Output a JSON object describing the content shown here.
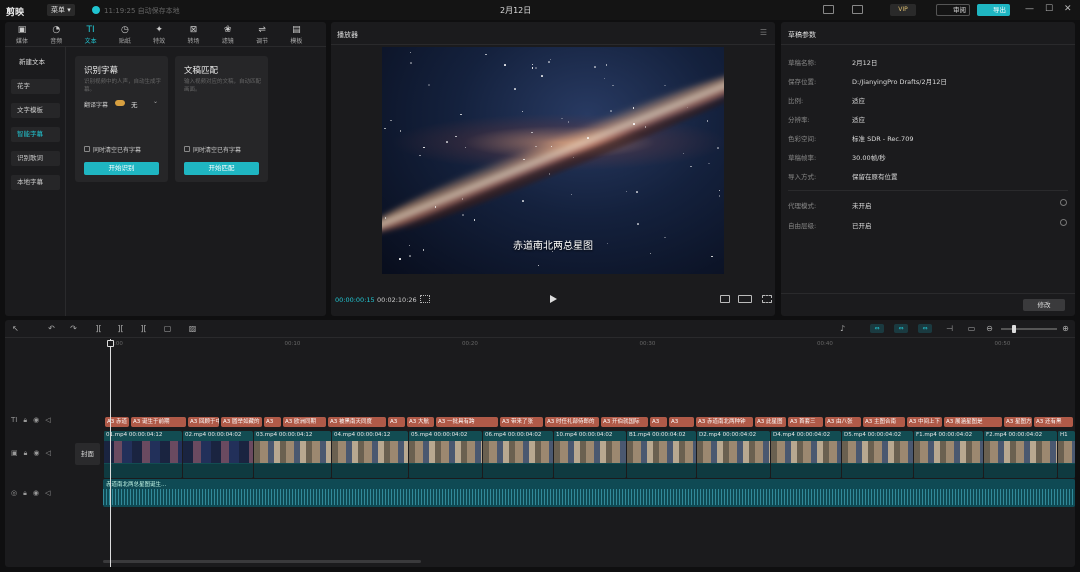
{
  "titlebar": {
    "app_name": "剪映",
    "menu": "菜单 ▾",
    "autosave": "11:19:25 自动保存本地",
    "title": "2月12日",
    "vip": "VIP",
    "review": "审阅",
    "export": "导出",
    "minimize": "—",
    "maximize": "☐",
    "close": "✕"
  },
  "tool_tabs": [
    {
      "label": "媒体",
      "icon": "▣"
    },
    {
      "label": "音频",
      "icon": "◔"
    },
    {
      "label": "文本",
      "icon": "TI"
    },
    {
      "label": "贴纸",
      "icon": "◷"
    },
    {
      "label": "特效",
      "icon": "✦"
    },
    {
      "label": "转场",
      "icon": "⊠"
    },
    {
      "label": "滤镜",
      "icon": "❀"
    },
    {
      "label": "调节",
      "icon": "⇌"
    },
    {
      "label": "模板",
      "icon": "▤"
    }
  ],
  "text_sidebar": [
    "新建文本",
    "花字",
    "文字模板",
    "智能字幕",
    "识别歌词",
    "本地字幕"
  ],
  "cards": [
    {
      "title": "识别字幕",
      "desc": "识别视频中的人声，自动生成字幕。",
      "option_label": "翻译字幕",
      "option_value": "无",
      "checkbox": "同时清空已有字幕",
      "button": "开始识别"
    },
    {
      "title": "文稿匹配",
      "desc": "输入视频对应的文稿，自动匹配画面。",
      "checkbox": "同时清空已有字幕",
      "button": "开始匹配"
    }
  ],
  "player": {
    "title": "播放器",
    "subtitle": "赤道南北两总星图",
    "current_time": "00:00:00:15",
    "total_time": "00:02:10:26"
  },
  "draft": {
    "title": "草稿参数",
    "rows": [
      {
        "key": "草稿名称:",
        "value": "2月12日"
      },
      {
        "key": "保存位置:",
        "value": "D:/JianyingPro Drafts/2月12日"
      },
      {
        "key": "比例:",
        "value": "适应"
      },
      {
        "key": "分辨率:",
        "value": "适应"
      },
      {
        "key": "色彩空间:",
        "value": "标准 SDR - Rec.709"
      },
      {
        "key": "草稿帧率:",
        "value": "30.00帧/秒"
      },
      {
        "key": "导入方式:",
        "value": "保留在原有位置"
      }
    ],
    "rows2": [
      {
        "key": "代理模式:",
        "value": "未开启"
      },
      {
        "key": "自由层级:",
        "value": "已开启"
      }
    ],
    "edit_button": "修改"
  },
  "timeline": {
    "ruler_ticks": [
      "00:00",
      "00:10",
      "00:20",
      "00:30",
      "00:40",
      "00:50"
    ],
    "cover_label": "封面",
    "text_clips": [
      "A3 赤道",
      "A3 诞生于前期",
      "A3 回顾于中间",
      "A3 圆举如藏的",
      "A3",
      "A3 欧洲同期",
      "A3 被黑南天同度",
      "A3",
      "A3 大航",
      "A3 一批具有跨",
      "A3 带来了张",
      "A3 时任礼部侍郎的",
      "A3 开伯就国际",
      "A3",
      "A3",
      "A3 赤道南北两种钟",
      "A3 此星图",
      "A3 首套三",
      "A3 由八张",
      "A3 主图合南",
      "A3 中间上下",
      "A3 展涵星图是",
      "A3 星图方",
      "A3 还有黑"
    ],
    "video_clips": [
      {
        "name": "01.mp4",
        "dur": "00:00:04:12"
      },
      {
        "name": "02.mp4",
        "dur": "00:00:04:02"
      },
      {
        "name": "03.mp4",
        "dur": "00:00:04:12"
      },
      {
        "name": "04.mp4",
        "dur": "00:00:04:12"
      },
      {
        "name": "05.mp4",
        "dur": "00:00:04:02"
      },
      {
        "name": "06.mp4",
        "dur": "00:00:04:02"
      },
      {
        "name": "10.mp4",
        "dur": "00:00:04:02"
      },
      {
        "name": "B1.mp4",
        "dur": "00:00:04:02"
      },
      {
        "name": "D2.mp4",
        "dur": "00:00:04:02"
      },
      {
        "name": "D4.mp4",
        "dur": "00:00:04:02"
      },
      {
        "name": "D5.mp4",
        "dur": "00:00:04:02"
      },
      {
        "name": "F1.mp4",
        "dur": "00:00:04:02"
      },
      {
        "name": "F2.mp4",
        "dur": "00:00:04:02"
      },
      {
        "name": "H1",
        "dur": ""
      }
    ],
    "audio_label": "赤道南北两总星图诞生..."
  }
}
